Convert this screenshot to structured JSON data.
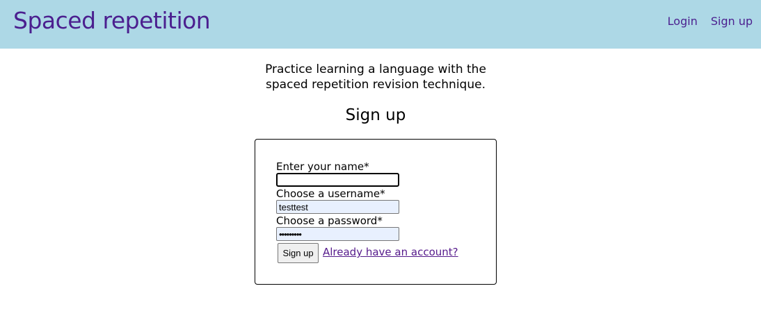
{
  "header": {
    "brand": "Spaced repetition",
    "nav": {
      "login": "Login",
      "signup": "Sign up"
    }
  },
  "intro": {
    "line1": "Practice learning a language with the",
    "line2": "spaced repetition revision technique."
  },
  "form": {
    "title": "Sign up",
    "name_label": "Enter your name*",
    "name_value": "",
    "username_label": "Choose a username*",
    "username_value": "testtest",
    "password_label": "Choose a password*",
    "password_value": "•••••••••",
    "submit_label": "Sign up",
    "login_link": "Already have an account?"
  },
  "colors": {
    "header_bg": "#add8e6",
    "brand": "#4b1f8f",
    "link_visited": "#551a8b",
    "autofill_bg": "#e8f0fe"
  }
}
